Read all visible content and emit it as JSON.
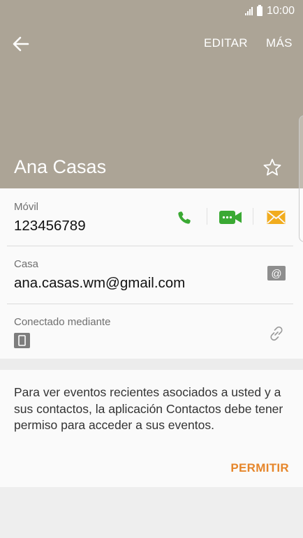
{
  "status_bar": {
    "time": "10:00"
  },
  "header": {
    "edit_label": "EDITAR",
    "more_label": "MÁS",
    "contact_name": "Ana Casas",
    "background_color": "#aca496"
  },
  "phone": {
    "label": "Móvil",
    "value": "123456789"
  },
  "email": {
    "label": "Casa",
    "value": "ana.casas.wm@gmail.com"
  },
  "linked": {
    "label": "Conectado mediante"
  },
  "permission_card": {
    "message": "Para ver eventos recientes asociados a usted y a sus contactos, la aplicación Contactos debe tener permiso para acceder a sus eventos.",
    "allow_label": "PERMITIR",
    "accent_color": "#e6862b"
  },
  "icons": {
    "call": "phone-icon",
    "video": "video-call-icon",
    "message": "message-icon",
    "email": "email-icon",
    "link": "link-icon",
    "device": "tablet-icon",
    "favorite": "star-icon",
    "back": "back-arrow-icon"
  }
}
